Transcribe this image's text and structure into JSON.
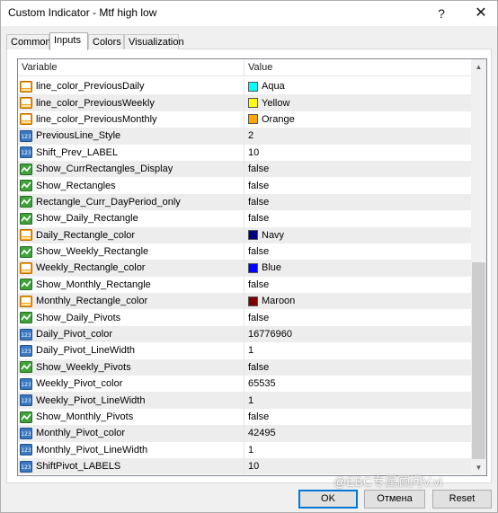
{
  "window": {
    "title": "Custom Indicator - Mtf high low",
    "help_label": "?",
    "close_label": "✕"
  },
  "tabs": [
    {
      "label": "Common"
    },
    {
      "label": "Inputs"
    },
    {
      "label": "Colors"
    },
    {
      "label": "Visualization"
    }
  ],
  "grid": {
    "header": {
      "variable": "Variable",
      "value": "Value"
    },
    "rows": [
      {
        "icon": "color",
        "name": "line_color_PreviousDaily",
        "value": "Aqua",
        "swatch": "#00ffff"
      },
      {
        "icon": "color",
        "name": "line_color_PreviousWeekly",
        "value": "Yellow",
        "swatch": "#ffff00"
      },
      {
        "icon": "color",
        "name": "line_color_PreviousMonthly",
        "value": "Orange",
        "swatch": "#ffa500"
      },
      {
        "icon": "number",
        "name": "PreviousLine_Style",
        "value": "2"
      },
      {
        "icon": "number",
        "name": "Shift_Prev_LABEL",
        "value": "10"
      },
      {
        "icon": "bool",
        "name": "Show_CurrRectangles_Display",
        "value": "false"
      },
      {
        "icon": "bool",
        "name": "Show_Rectangles",
        "value": "false"
      },
      {
        "icon": "bool",
        "name": "Rectangle_Curr_DayPeriod_only",
        "value": "false"
      },
      {
        "icon": "bool",
        "name": "Show_Daily_Rectangle",
        "value": "false"
      },
      {
        "icon": "color",
        "name": "Daily_Rectangle_color",
        "value": "Navy",
        "swatch": "#000080"
      },
      {
        "icon": "bool",
        "name": "Show_Weekly_Rectangle",
        "value": "false"
      },
      {
        "icon": "color",
        "name": "Weekly_Rectangle_color",
        "value": "Blue",
        "swatch": "#0000ff"
      },
      {
        "icon": "bool",
        "name": "Show_Monthly_Rectangle",
        "value": "false"
      },
      {
        "icon": "color",
        "name": "Monthly_Rectangle_color",
        "value": "Maroon",
        "swatch": "#800000"
      },
      {
        "icon": "bool",
        "name": "Show_Daily_Pivots",
        "value": "false"
      },
      {
        "icon": "number",
        "name": "Daily_Pivot_color",
        "value": "16776960"
      },
      {
        "icon": "number",
        "name": "Daily_Pivot_LineWidth",
        "value": "1"
      },
      {
        "icon": "bool",
        "name": "Show_Weekly_Pivots",
        "value": "false"
      },
      {
        "icon": "number",
        "name": "Weekly_Pivot_color",
        "value": "65535"
      },
      {
        "icon": "number",
        "name": "Weekly_Pivot_LineWidth",
        "value": "1"
      },
      {
        "icon": "bool",
        "name": "Show_Monthly_Pivots",
        "value": "false"
      },
      {
        "icon": "number",
        "name": "Monthly_Pivot_color",
        "value": "42495"
      },
      {
        "icon": "number",
        "name": "Monthly_Pivot_LineWidth",
        "value": "1"
      },
      {
        "icon": "number",
        "name": "ShiftPivot_LABELS",
        "value": "10"
      }
    ]
  },
  "buttons": {
    "ok": "OK",
    "cancel": "Отмена",
    "reset": "Reset"
  },
  "watermark": "@EBC专属顾问V.vi",
  "colors": {
    "icon_color_bg": "#f7a21b",
    "icon_number_bg": "#3a78c2",
    "icon_bool_bg": "#3fa33a"
  }
}
